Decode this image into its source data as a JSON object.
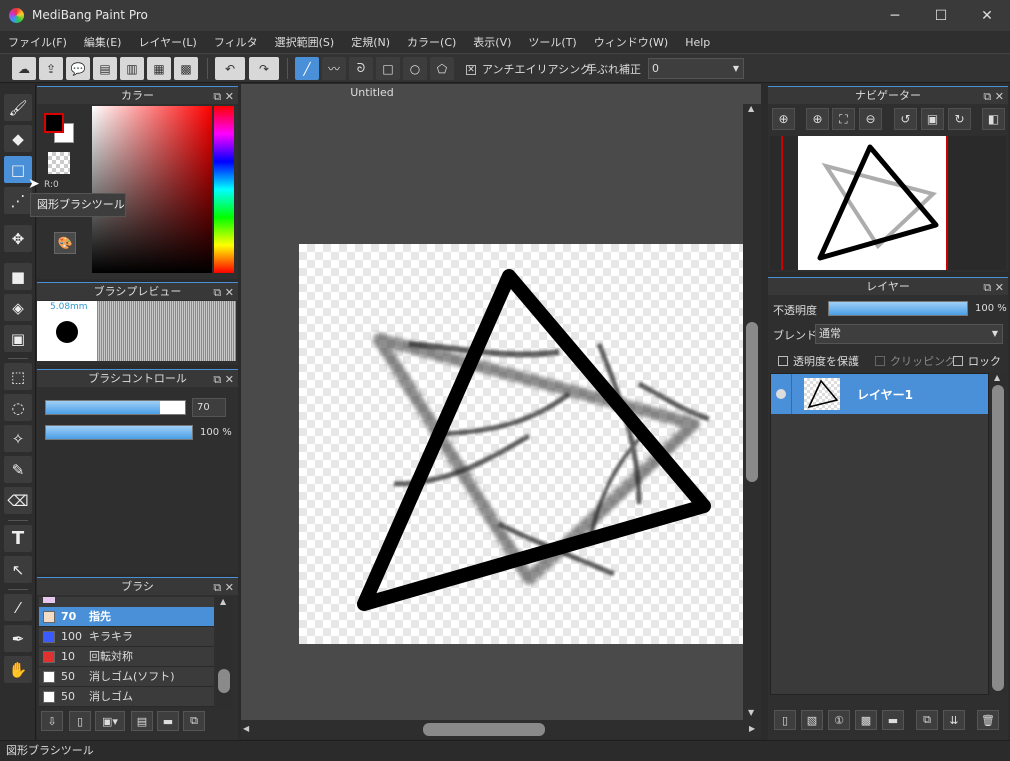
{
  "window": {
    "title": "MediBang Paint Pro",
    "min": "─",
    "max": "☐",
    "close": "✕"
  },
  "menu": [
    "ファイル(F)",
    "編集(E)",
    "レイヤー(L)",
    "フィルタ",
    "選択範囲(S)",
    "定規(N)",
    "カラー(C)",
    "表示(V)",
    "ツール(T)",
    "ウィンドウ(W)",
    "Help"
  ],
  "toolbar": {
    "antialias_label": "アンチエイリアシング",
    "stabilizer_label": "手ぶれ補正",
    "stabilizer_value": "0"
  },
  "tooltip": "図形ブラシツール",
  "color_panel": {
    "title": "カラー",
    "readout": "R:0",
    "fg": "#000000",
    "bg": "#ffffff"
  },
  "brush_preview": {
    "title": "ブラシプレビュー",
    "size": "5.08mm"
  },
  "brush_control": {
    "title": "ブラシコントロール",
    "size_value": "70",
    "size_fraction": 0.82,
    "opacity_value": "100 %",
    "opacity_fraction": 1.0
  },
  "brush_panel": {
    "title": "ブラシ",
    "items": [
      {
        "size": "70",
        "name": "指先",
        "color": "#f2dcc6",
        "selected": true
      },
      {
        "size": "100",
        "name": "キラキラ",
        "color": "#3b5bff",
        "selected": false
      },
      {
        "size": "10",
        "name": "回転対称",
        "color": "#e03030",
        "selected": false
      },
      {
        "size": "50",
        "name": "消しゴム(ソフト)",
        "color": "#ffffff",
        "selected": false
      },
      {
        "size": "50",
        "name": "消しゴム",
        "color": "#ffffff",
        "selected": false
      }
    ]
  },
  "canvas": {
    "tab_title": "Untitled"
  },
  "navigator": {
    "title": "ナビゲーター"
  },
  "layer_panel": {
    "title": "レイヤー",
    "opacity_label": "不透明度",
    "opacity_value": "100 %",
    "blend_label": "ブレンド",
    "blend_value": "通常",
    "protect_label": "透明度を保護",
    "clipping_label": "クリッピング",
    "lock_label": "ロック",
    "layers": [
      {
        "name": "レイヤー1",
        "selected": true
      }
    ]
  },
  "status": "図形ブラシツール",
  "colors": {
    "accent": "#4a90d9",
    "selected_layer": "#4a90d9"
  }
}
